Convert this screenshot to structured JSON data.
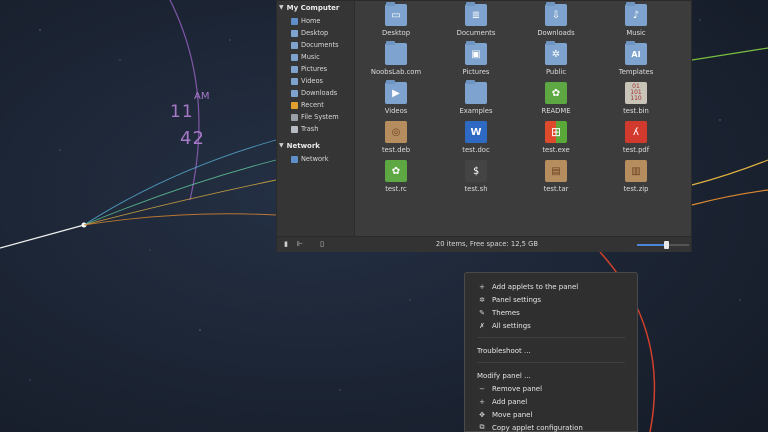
{
  "clock": {
    "hour": "11",
    "ampm": "AM",
    "minute": "42"
  },
  "sidebar": {
    "sections": [
      {
        "title": "My Computer",
        "items": [
          {
            "label": "Home",
            "icon": "home-icon"
          },
          {
            "label": "Desktop",
            "icon": "desktop-icon"
          },
          {
            "label": "Documents",
            "icon": "documents-icon"
          },
          {
            "label": "Music",
            "icon": "music-icon"
          },
          {
            "label": "Pictures",
            "icon": "pictures-icon"
          },
          {
            "label": "Videos",
            "icon": "videos-icon"
          },
          {
            "label": "Downloads",
            "icon": "downloads-icon"
          },
          {
            "label": "Recent",
            "icon": "recent-icon"
          },
          {
            "label": "File System",
            "icon": "filesystem-icon"
          },
          {
            "label": "Trash",
            "icon": "trash-icon"
          }
        ]
      },
      {
        "title": "Network",
        "items": [
          {
            "label": "Network",
            "icon": "network-icon"
          }
        ]
      }
    ]
  },
  "files": [
    {
      "label": "Desktop",
      "icon": "desktop-folder-icon"
    },
    {
      "label": "Documents",
      "icon": "documents-folder-icon"
    },
    {
      "label": "Downloads",
      "icon": "downloads-folder-icon"
    },
    {
      "label": "Music",
      "icon": "music-folder-icon"
    },
    {
      "label": "NoobsLab.com",
      "icon": "folder-icon"
    },
    {
      "label": "Pictures",
      "icon": "pictures-folder-icon"
    },
    {
      "label": "Public",
      "icon": "public-folder-icon"
    },
    {
      "label": "Templates",
      "icon": "templates-folder-icon"
    },
    {
      "label": "Videos",
      "icon": "videos-folder-icon"
    },
    {
      "label": "Examples",
      "icon": "folder-icon"
    },
    {
      "label": "README",
      "icon": "readme-file-icon"
    },
    {
      "label": "test.bin",
      "icon": "binary-file-icon"
    },
    {
      "label": "test.deb",
      "icon": "deb-package-icon"
    },
    {
      "label": "test.doc",
      "icon": "word-document-icon"
    },
    {
      "label": "test.exe",
      "icon": "exe-file-icon"
    },
    {
      "label": "test.pdf",
      "icon": "pdf-file-icon"
    },
    {
      "label": "test.rc",
      "icon": "rc-file-icon"
    },
    {
      "label": "test.sh",
      "icon": "shell-script-icon"
    },
    {
      "label": "test.tar",
      "icon": "tar-archive-icon"
    },
    {
      "label": "test.zip",
      "icon": "zip-archive-icon"
    }
  ],
  "statusbar": {
    "text": "20 items, Free space: 12,5 GB",
    "zoom_level": 0.55
  },
  "menu": {
    "group1": [
      {
        "label": "Add applets to the panel",
        "icon": "plus-icon"
      },
      {
        "label": "Panel settings",
        "icon": "gear-icon"
      },
      {
        "label": "Themes",
        "icon": "brush-icon"
      },
      {
        "label": "All settings",
        "icon": "tools-icon"
      }
    ],
    "troubleshoot": "Troubleshoot ...",
    "modify": "Modify panel ...",
    "group2": [
      {
        "label": "Remove panel",
        "icon": "minus-icon"
      },
      {
        "label": "Add panel",
        "icon": "plus-icon"
      },
      {
        "label": "Move panel",
        "icon": "move-icon"
      },
      {
        "label": "Copy applet configuration",
        "icon": "copy-icon"
      }
    ]
  },
  "colors": {
    "folder": "#7ea3cf",
    "accent_blue": "#4a86d8",
    "clock": "#a779c8"
  }
}
